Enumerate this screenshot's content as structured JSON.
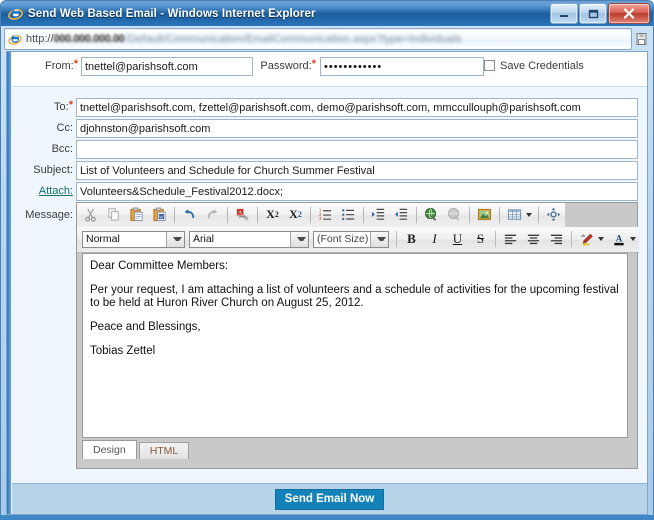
{
  "window": {
    "title": "Send Web Based Email - Windows Internet Explorer",
    "icons": {
      "app": "ie-logo-icon",
      "minimize": "minimize-icon",
      "maximize": "maximize-icon",
      "close": "close-icon"
    }
  },
  "address_bar": {
    "protocol": "http://",
    "redacted_host": "000.000.000.00",
    "redacted_path": "/Default/Communication/EmailCommunication.aspx?type=Individuals",
    "page_icon": "page-document-icon"
  },
  "form": {
    "from": {
      "label": "From:",
      "required": true,
      "value": "tnettel@parishsoft.com"
    },
    "password": {
      "label": "Password:",
      "required": true,
      "value": "••••••••••••"
    },
    "save_credentials": {
      "label": "Save Credentials",
      "checked": false
    },
    "to": {
      "label": "To:",
      "required": true,
      "value": "tnettel@parishsoft.com, fzettel@parishsoft.com, demo@parishsoft.com, mmccullouph@parishsoft.com"
    },
    "cc": {
      "label": "Cc:",
      "required": false,
      "value": "djohnston@parishsoft.com"
    },
    "bcc": {
      "label": "Bcc:",
      "required": false,
      "value": ""
    },
    "subject": {
      "label": "Subject:",
      "required": false,
      "value": "List of Volunteers and Schedule for Church Summer Festival"
    },
    "attach": {
      "label": "Attach:",
      "required": false,
      "value": "Volunteers&Schedule_Festival2012.docx;"
    },
    "message": {
      "label": "Message:"
    }
  },
  "editor": {
    "toolbar_row1": [
      {
        "name": "cut-icon",
        "title": "Cut"
      },
      {
        "name": "copy-icon",
        "title": "Copy"
      },
      {
        "name": "paste-icon",
        "title": "Paste"
      },
      {
        "name": "paste-from-word-icon",
        "title": "Paste from Word"
      },
      {
        "name": "undo-icon",
        "title": "Undo"
      },
      {
        "name": "redo-icon",
        "title": "Redo"
      },
      {
        "name": "remove-format-icon",
        "title": "Remove Format"
      },
      {
        "name": "superscript-icon",
        "title": "Superscript"
      },
      {
        "name": "subscript-icon",
        "title": "Subscript"
      },
      {
        "name": "numbered-list-icon",
        "title": "Numbered List"
      },
      {
        "name": "bulleted-list-icon",
        "title": "Bulleted List"
      },
      {
        "name": "indent-icon",
        "title": "Increase Indent"
      },
      {
        "name": "outdent-icon",
        "title": "Decrease Indent"
      },
      {
        "name": "insert-link-icon",
        "title": "Insert Link"
      },
      {
        "name": "unlink-icon",
        "title": "Remove Link"
      },
      {
        "name": "insert-image-icon",
        "title": "Insert Image"
      },
      {
        "name": "insert-table-icon",
        "title": "Insert Table"
      },
      {
        "name": "resize-icon",
        "title": "Resize Editor"
      }
    ],
    "paragraph_style": "Normal",
    "font_family": "Arial",
    "font_size": "(Font Size)",
    "toolbar_row2": [
      {
        "name": "bold-icon",
        "glyph": "B"
      },
      {
        "name": "italic-icon",
        "glyph": "I"
      },
      {
        "name": "underline-icon",
        "glyph": "U"
      },
      {
        "name": "strikethrough-icon",
        "glyph": "S"
      },
      {
        "name": "align-left-icon"
      },
      {
        "name": "align-center-icon"
      },
      {
        "name": "align-right-icon"
      },
      {
        "name": "highlight-color-icon"
      },
      {
        "name": "font-color-icon"
      }
    ],
    "body_paragraphs": [
      "Dear Committee Members:",
      "Per your request, I am attaching a list of volunteers and a schedule of activities for the upcoming festival to be held at Huron River Church on August 25, 2012.",
      "Peace and Blessings,",
      "Tobias Zettel"
    ],
    "tabs": [
      {
        "label": "Design",
        "active": true
      },
      {
        "label": "HTML",
        "active": false
      }
    ]
  },
  "footer": {
    "send_button": "Send Email Now"
  },
  "colors": {
    "accent": "#1382b8",
    "required_marker": "#e03c1c",
    "link": "#18706b",
    "title_bar": "#1f6fbe",
    "page_bg": "#eff6fd"
  }
}
